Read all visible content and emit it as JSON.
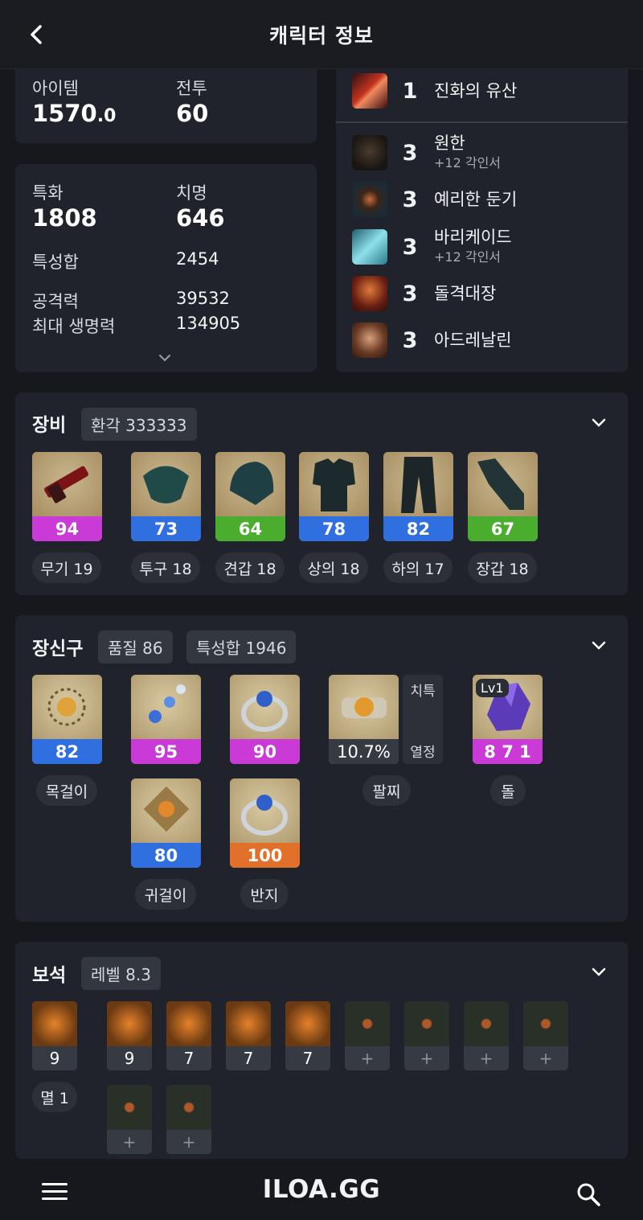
{
  "header": {
    "title": "캐릭터 정보",
    "back_icon": "chevron-left-icon"
  },
  "level_card": {
    "item_label": "아이템",
    "item_value_main": "1570",
    "item_value_dec": ".0",
    "combat_label": "전투",
    "combat_value": "60"
  },
  "stats_card": {
    "spec_label": "특화",
    "spec_value": "1808",
    "crit_label": "치명",
    "crit_value": "646",
    "total_label": "특성합",
    "total_value": "2454",
    "atk_label": "공격력",
    "atk_value": "39532",
    "hp_label": "최대 생명력",
    "hp_value": "134905"
  },
  "engravings": {
    "top": {
      "level": "1",
      "name": "진화의 유산"
    },
    "items": [
      {
        "level": "3",
        "name": "원한",
        "sub": "+12 각인서"
      },
      {
        "level": "3",
        "name": "예리한 둔기",
        "sub": ""
      },
      {
        "level": "3",
        "name": "바리케이드",
        "sub": "+12 각인서"
      },
      {
        "level": "3",
        "name": "돌격대장",
        "sub": ""
      },
      {
        "level": "3",
        "name": "아드레날린",
        "sub": ""
      }
    ]
  },
  "equipment": {
    "title": "장비",
    "tag": "환각 333333",
    "items": [
      {
        "quality": "94",
        "label": "무기 19",
        "grade_color": "#c93ad6"
      },
      {
        "quality": "73",
        "label": "투구 18",
        "grade_color": "#2f6fe0"
      },
      {
        "quality": "64",
        "label": "견갑 18",
        "grade_color": "#4aad2e"
      },
      {
        "quality": "78",
        "label": "상의 18",
        "grade_color": "#2f6fe0"
      },
      {
        "quality": "82",
        "label": "하의 17",
        "grade_color": "#2f6fe0"
      },
      {
        "quality": "67",
        "label": "장갑 18",
        "grade_color": "#4aad2e"
      }
    ]
  },
  "accessories": {
    "title": "장신구",
    "tag_quality": "품질 86",
    "tag_stats": "특성합 1946",
    "necklace": {
      "quality": "82",
      "label": "목걸이"
    },
    "earring1": {
      "quality": "95"
    },
    "earring2": {
      "quality": "80"
    },
    "earring_label": "귀걸이",
    "ring1": {
      "quality": "90"
    },
    "ring2": {
      "quality": "100"
    },
    "ring_label": "반지",
    "bracelet": {
      "value": "10.7%",
      "label": "팔찌",
      "stat1": "치특",
      "stat2": "열정"
    },
    "stone": {
      "level": "Lv1",
      "value": "8 7 1",
      "label": "돌"
    }
  },
  "gems": {
    "title": "보석",
    "tag": "레벨 8.3",
    "first": {
      "level": "9",
      "label": "멸 1"
    },
    "row1": [
      "9",
      "7",
      "7",
      "7"
    ],
    "empty_label": "+"
  },
  "bottom_nav": {
    "brand": "ILOA.GG",
    "menu_icon": "hamburger-menu-icon",
    "search_icon": "search-icon"
  },
  "colors": {
    "bg": "#16181d",
    "card": "#20232b",
    "purple": "#c93ad6",
    "blue": "#2f6fe0",
    "green": "#4aad2e",
    "orange": "#e2702a"
  }
}
